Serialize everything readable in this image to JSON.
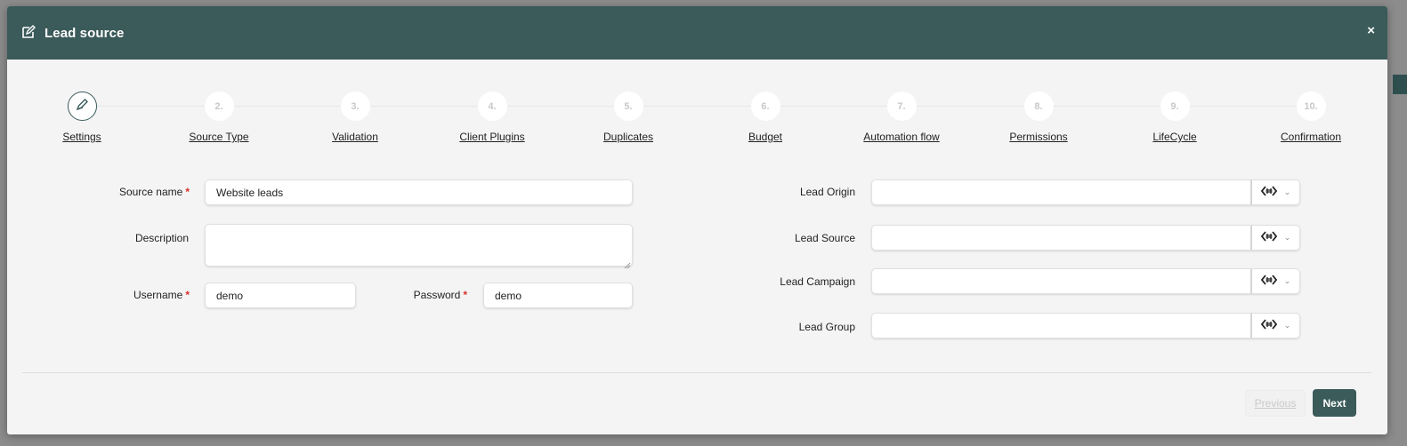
{
  "modal": {
    "title": "Lead source",
    "close": "×"
  },
  "steps": [
    {
      "num": "",
      "label": "Settings",
      "active": true
    },
    {
      "num": "2.",
      "label": "Source Type"
    },
    {
      "num": "3.",
      "label": "Validation"
    },
    {
      "num": "4.",
      "label": "Client Plugins"
    },
    {
      "num": "5.",
      "label": "Duplicates"
    },
    {
      "num": "6.",
      "label": "Budget"
    },
    {
      "num": "7.",
      "label": "Automation flow"
    },
    {
      "num": "8.",
      "label": "Permissions"
    },
    {
      "num": "9.",
      "label": "LifeCycle"
    },
    {
      "num": "10.",
      "label": "Confirmation"
    }
  ],
  "form": {
    "source_name": {
      "label": "Source name",
      "value": "Website leads"
    },
    "description": {
      "label": "Description",
      "value": ""
    },
    "username": {
      "label": "Username",
      "value": "demo"
    },
    "password": {
      "label": "Password",
      "value": "demo"
    },
    "required_mark": "*",
    "lead_origin": {
      "label": "Lead Origin",
      "value": ""
    },
    "lead_source": {
      "label": "Lead Source",
      "value": ""
    },
    "lead_campaign": {
      "label": "Lead Campaign",
      "value": ""
    },
    "lead_group": {
      "label": "Lead Group",
      "value": ""
    }
  },
  "footer": {
    "previous": "Previous",
    "next": "Next"
  },
  "colors": {
    "header": "#3b5a5a",
    "required": "#d9302b"
  }
}
